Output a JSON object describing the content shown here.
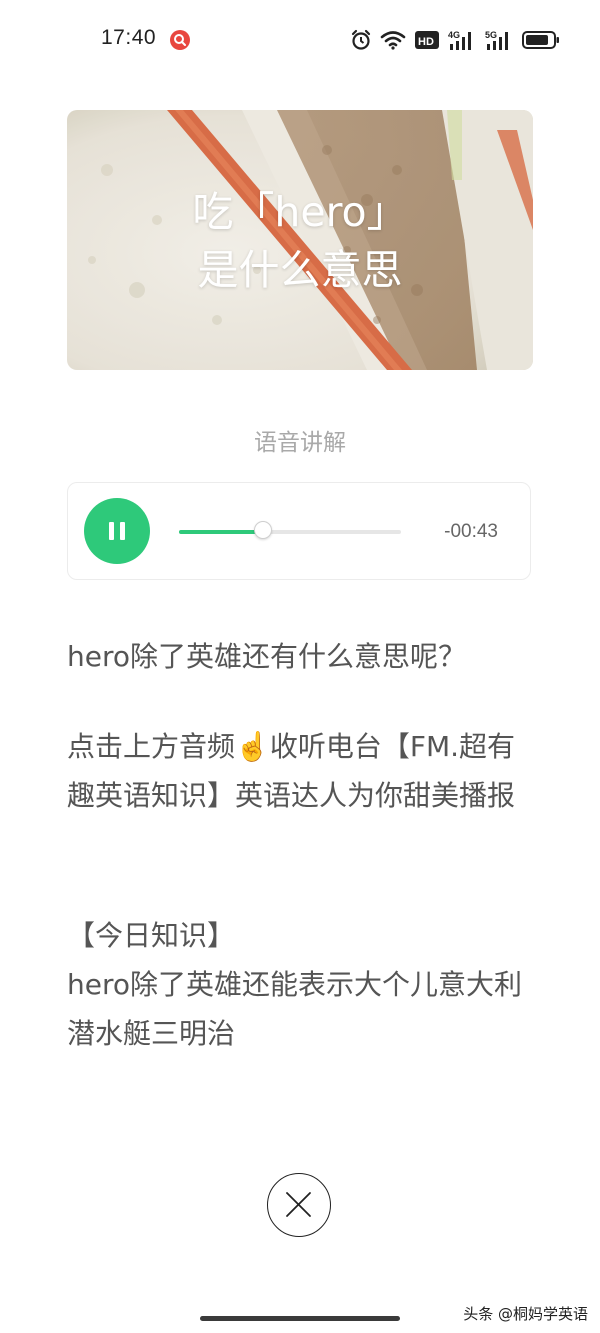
{
  "status": {
    "time": "17:40",
    "icons": [
      "search-notification-icon",
      "alarm-icon",
      "wifi-icon",
      "hd-icon",
      "signal-4g-icon",
      "signal-5g-icon",
      "battery-icon"
    ],
    "hd_label": "HD",
    "net1_label": "4G",
    "net2_label": "5G"
  },
  "cover": {
    "line1": "吃「hero」",
    "line2": "是什么意思"
  },
  "section_label": "语音讲解",
  "player": {
    "state": "playing",
    "progress": 0.38,
    "remaining": "-00:43",
    "accent_color": "#2ec97a"
  },
  "body": {
    "p1": "hero除了英雄还有什么意思呢？",
    "p2": "点击上方音频☝️收听电台【FM.超有趣英语知识】英语达人为你甜美播报",
    "p3_line1": "【今日知识】",
    "p3_line2": "hero除了英雄还能表示大个儿意大利潜水艇三明治"
  },
  "watermark": "头条 @桐妈学英语"
}
